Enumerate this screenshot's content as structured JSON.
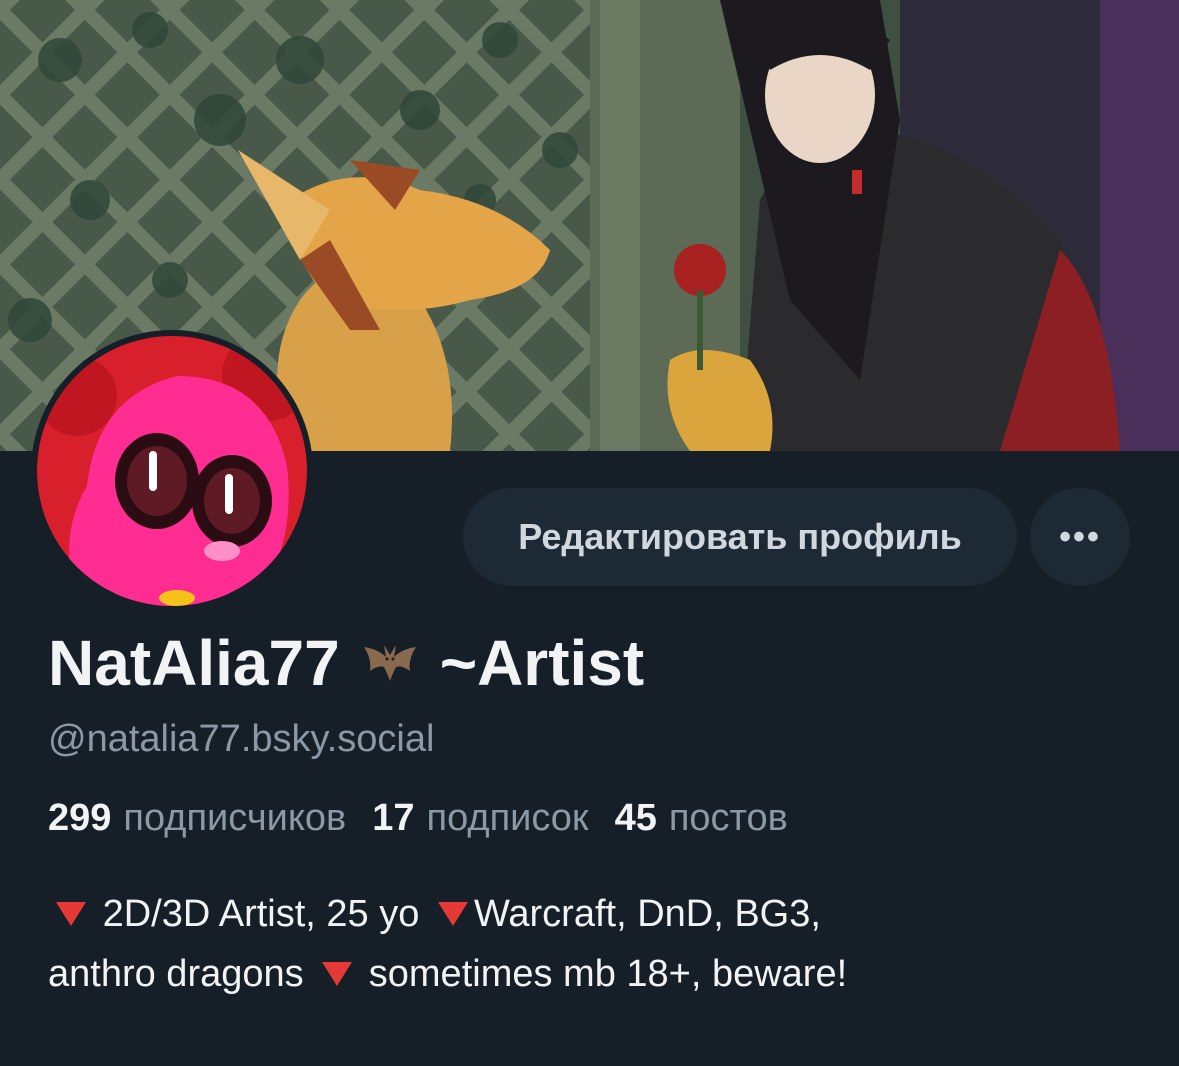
{
  "profile": {
    "display_name": "NatAlia77",
    "display_name_suffix": "~Artist",
    "name_emoji": "bat-icon",
    "handle": "@natalia77.bsky.social",
    "edit_button_label": "Редактировать профиль",
    "more_button_label": "•••"
  },
  "stats": {
    "followers_count": "299",
    "followers_label": "подписчиков",
    "following_count": "17",
    "following_label": "подписок",
    "posts_count": "45",
    "posts_label": "постов"
  },
  "bio": {
    "marker_icon": "red-triangle-down-icon",
    "segments": [
      "2D/3D Artist, 25 yo",
      "Warcraft, DnD, BG3,",
      "anthro dragons",
      "sometimes mb 18+, beware!"
    ]
  },
  "colors": {
    "background": "#161e27",
    "button_bg": "#1e2936",
    "muted_text": "#8b98a6",
    "marker_red": "#e53935",
    "avatar_pink": "#ff1f8e"
  }
}
